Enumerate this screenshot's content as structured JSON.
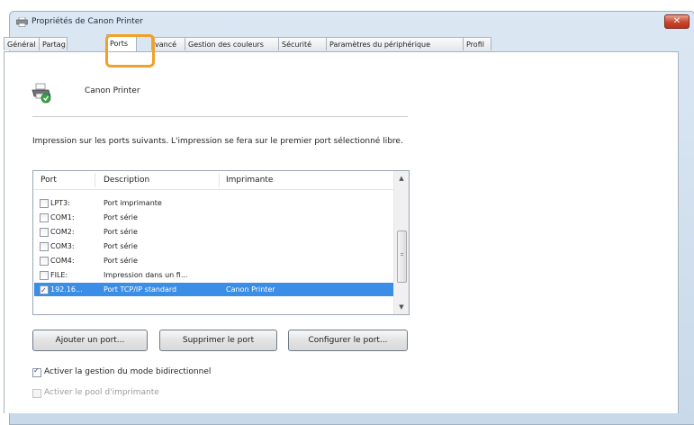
{
  "window": {
    "title": "Propriétés de Canon Printer",
    "close_label": "✕",
    "app_icon": "printer-icon"
  },
  "tabs": [
    {
      "label": "Général"
    },
    {
      "label": "Partag"
    },
    {
      "label": "Ports"
    },
    {
      "label": "vancé"
    },
    {
      "label": "Gestion des couleurs"
    },
    {
      "label": "Sécurité"
    },
    {
      "label": "Paramètres du périphérique"
    },
    {
      "label": "Profil"
    }
  ],
  "printer": {
    "name": "Canon Printer",
    "icon": "printer-check-icon"
  },
  "description": "Impression sur les ports suivants. L'impression se fera sur le premier port sélectionné libre.",
  "list": {
    "headers": {
      "port": "Port",
      "description": "Description",
      "printer": "Imprimante"
    },
    "rows": [
      {
        "checked": false,
        "port": "LPT3:",
        "description": "Port imprimante",
        "printer": ""
      },
      {
        "checked": false,
        "port": "COM1:",
        "description": "Port série",
        "printer": ""
      },
      {
        "checked": false,
        "port": "COM2:",
        "description": "Port série",
        "printer": ""
      },
      {
        "checked": false,
        "port": "COM3:",
        "description": "Port série",
        "printer": ""
      },
      {
        "checked": false,
        "port": "COM4:",
        "description": "Port série",
        "printer": ""
      },
      {
        "checked": false,
        "port": "FILE:",
        "description": "Impression dans un fi...",
        "printer": ""
      },
      {
        "checked": true,
        "port": "192.16...",
        "description": "Port TCP/IP standard",
        "printer": "Canon Printer",
        "selected": true
      }
    ]
  },
  "buttons": {
    "add": "Ajouter un port...",
    "delete": "Supprimer le port",
    "configure": "Configurer le port..."
  },
  "options": {
    "bidirectional": {
      "label": "Activer la gestion du mode bidirectionnel",
      "checked": true,
      "enabled": true
    },
    "pool": {
      "label": "Activer le pool d'imprimante",
      "checked": false,
      "enabled": false
    }
  },
  "colors": {
    "highlight": "#f0a12a",
    "selection": "#3a8ee6"
  }
}
